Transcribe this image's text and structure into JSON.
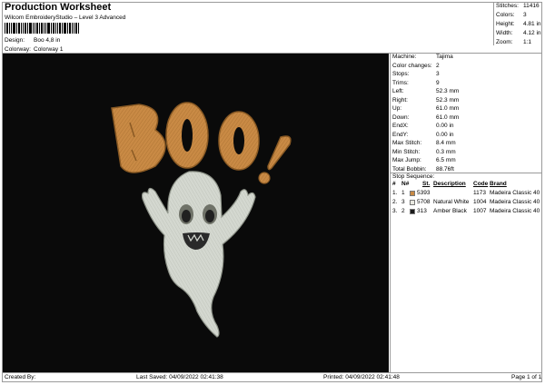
{
  "header": {
    "title": "Production Worksheet",
    "subtitle": "Wilcom EmbroideryStudio – Level 3 Advanced"
  },
  "meta": [
    {
      "key": "Design:",
      "value": "Boo 4,8 in"
    },
    {
      "key": "Colorway:",
      "value": "Colorway 1"
    }
  ],
  "stats": [
    {
      "key": "Stitches:",
      "value": "11416"
    },
    {
      "key": "Colors:",
      "value": "3"
    },
    {
      "key": "Height:",
      "value": "4.81 in"
    },
    {
      "key": "Width:",
      "value": "4.12 in"
    },
    {
      "key": "Zoom:",
      "value": "1:1"
    }
  ],
  "specs": [
    {
      "key": "Machine:",
      "value": "Tajima"
    },
    {
      "key": "Color changes:",
      "value": "2"
    },
    {
      "key": "Stops:",
      "value": "3"
    },
    {
      "key": "Trims:",
      "value": "9"
    },
    {
      "key": "Left:",
      "value": "52.3 mm"
    },
    {
      "key": "Right:",
      "value": "52.3 mm"
    },
    {
      "key": "Up:",
      "value": "61.0 mm"
    },
    {
      "key": "Down:",
      "value": "61.0 mm"
    },
    {
      "key": "EndX:",
      "value": "0.00 in"
    },
    {
      "key": "EndY:",
      "value": "0.00 in"
    },
    {
      "key": "Max Stitch:",
      "value": "8.4 mm"
    },
    {
      "key": "Min Stitch:",
      "value": "0.3 mm"
    },
    {
      "key": "Max Jump:",
      "value": "6.5 mm"
    },
    {
      "key": "Total Bobbin:",
      "value": "88.76ft"
    }
  ],
  "sequence": {
    "heading": "Stop Sequence:",
    "columns": [
      "#",
      "N#",
      "St.",
      "Description",
      "Code",
      "Brand"
    ],
    "rows": [
      {
        "num": "1.",
        "n": "1",
        "st": "5393",
        "desc": "",
        "code": "1173",
        "brand": "Madeira Classic 40",
        "color": "#c98a45"
      },
      {
        "num": "2.",
        "n": "3",
        "st": "5708",
        "desc": "Natural White",
        "code": "1004",
        "brand": "Madeira Classic 40",
        "color": "#e8e8e0"
      },
      {
        "num": "3.",
        "n": "2",
        "st": "313",
        "desc": "Amber Black",
        "code": "1007",
        "brand": "Madeira Classic 40",
        "color": "#1a1a1a"
      }
    ]
  },
  "design_text": "BOO!",
  "colors": {
    "orange_thread": "#c98a45",
    "white_thread": "#d4d8d0",
    "black_thread": "#1a1a1a",
    "background": "#0a0a0a"
  },
  "footer": {
    "created_by": "Created By:",
    "last_saved": "Last Saved: 04/09/2022 02:41:38",
    "printed": "Printed: 04/09/2022 02:41:48",
    "page": "Page 1 of 1"
  }
}
